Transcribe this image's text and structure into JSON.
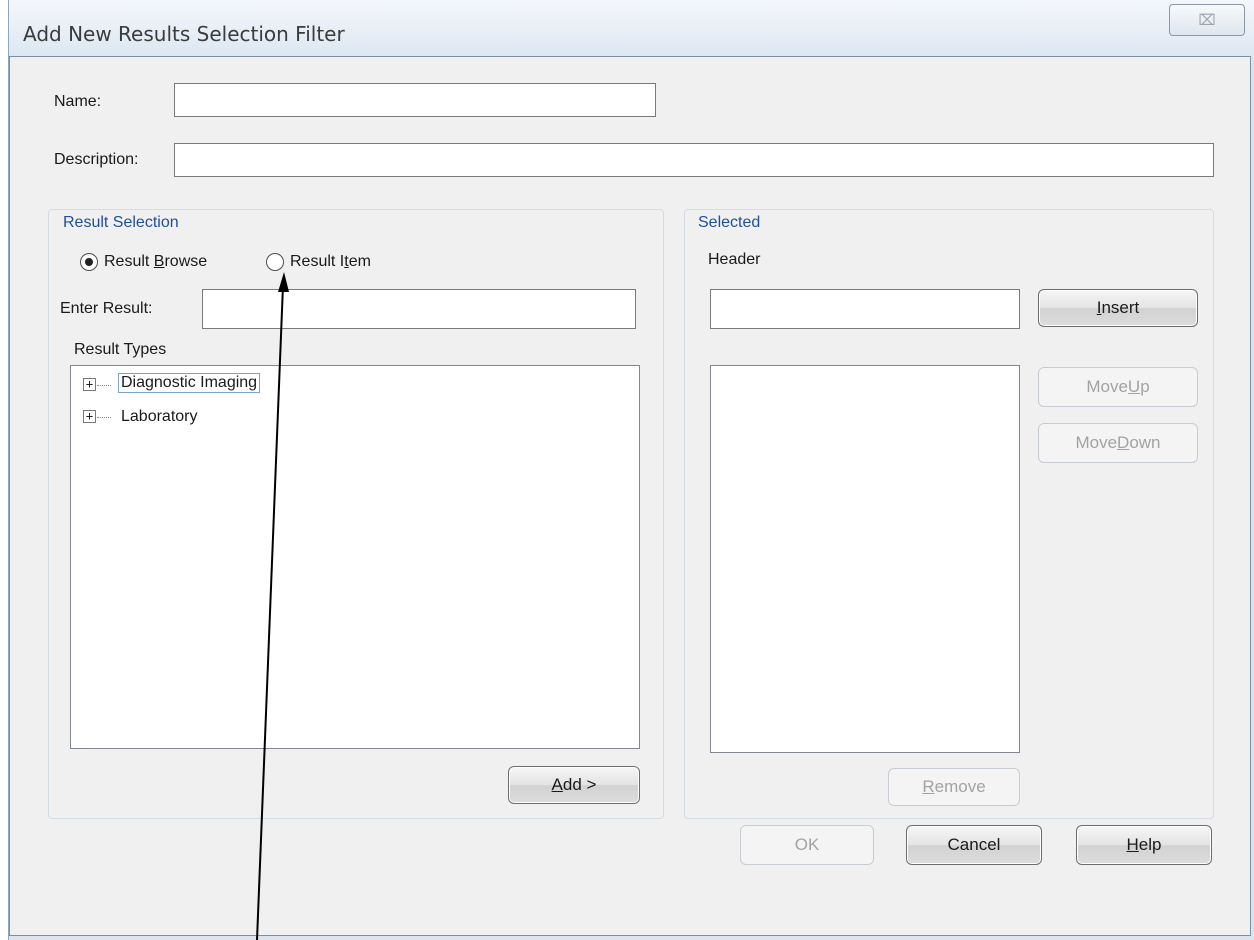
{
  "window": {
    "title": "Add New Results Selection Filter",
    "close_glyph": "⌧"
  },
  "form": {
    "name_label": "Name:",
    "name_value": "",
    "description_label": "Description:",
    "description_value": ""
  },
  "result_selection": {
    "title": "Result Selection",
    "radio_browse": {
      "pre": "Result ",
      "accel": "B",
      "post": "rowse",
      "checked": true
    },
    "radio_item": {
      "pre": "Result I",
      "accel": "t",
      "post": "em",
      "checked": false
    },
    "enter_result_label": "Enter Result:",
    "enter_result_value": "",
    "result_types_label": "Result Types",
    "tree": [
      {
        "label": "Diagnostic Imaging",
        "expander": "+",
        "focused": true
      },
      {
        "label": "Laboratory",
        "expander": "+",
        "focused": false
      }
    ],
    "add_button": {
      "accel": "A",
      "post": "dd >"
    }
  },
  "selected": {
    "title": "Selected",
    "header_label": "Header",
    "header_value": "",
    "insert_button": {
      "accel": "I",
      "post": "nsert"
    },
    "move_up_button": {
      "pre": "Move ",
      "accel": "U",
      "post": "p"
    },
    "move_down_button": {
      "pre": "Move ",
      "accel": "D",
      "post": "own"
    },
    "remove_button": {
      "accel": "R",
      "post": "emove"
    }
  },
  "footer": {
    "ok_label": "OK",
    "cancel_label": "Cancel",
    "help_button": {
      "accel": "H",
      "post": "elp"
    }
  },
  "annotation": {
    "type": "pointer-arrow",
    "points_to": "result-item-radio"
  }
}
